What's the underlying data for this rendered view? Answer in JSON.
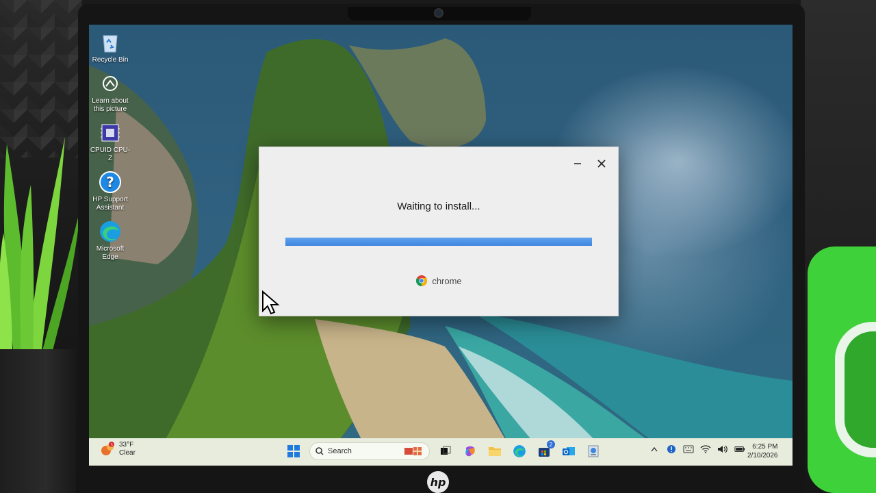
{
  "desktop": {
    "icons": [
      {
        "label": "Recycle Bin",
        "icon": "recycle-bin-icon"
      },
      {
        "label": "Learn about this picture",
        "icon": "camera-icon"
      },
      {
        "label": "CPUID CPU-Z",
        "icon": "cpu-z-icon"
      },
      {
        "label": "HP Support Assistant",
        "icon": "help-icon"
      },
      {
        "label": "Microsoft Edge",
        "icon": "edge-icon"
      }
    ]
  },
  "installer": {
    "status": "Waiting to install...",
    "progress_percent": 100,
    "brand": "chrome",
    "colors": {
      "progress": "#3f86df",
      "dialog_bg": "#eeeeee"
    }
  },
  "taskbar": {
    "weather": {
      "temperature": "33°F",
      "condition": "Clear"
    },
    "search": {
      "placeholder": "Search"
    },
    "notification_count": "2",
    "clock": {
      "time": "6:25 PM",
      "date": "2/10/2026"
    }
  },
  "device": {
    "logo": "hp"
  }
}
